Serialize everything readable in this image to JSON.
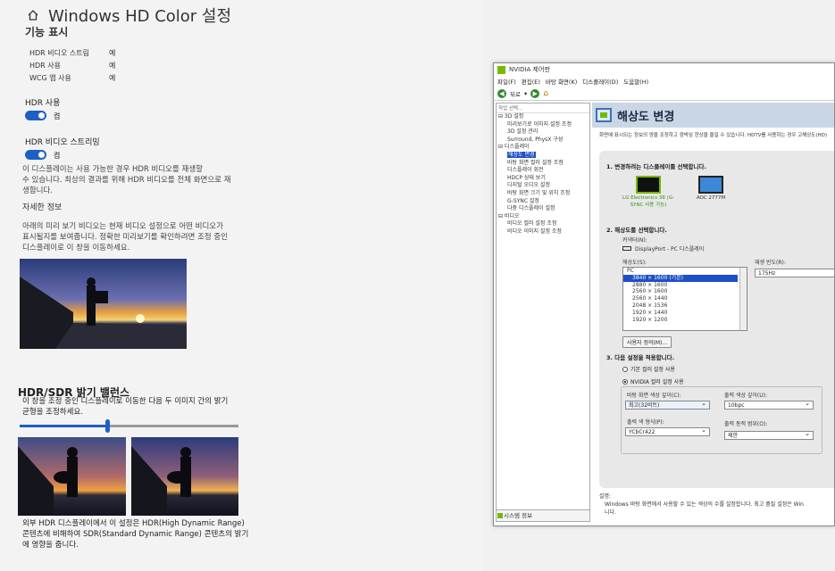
{
  "hdcolor": {
    "title": "Windows HD Color 설정",
    "section": "기능 표시",
    "features": [
      {
        "label": "HDR 비디오 스트림",
        "value": "예"
      },
      {
        "label": "HDR 사용",
        "value": "예"
      },
      {
        "label": "WCG 앱 사용",
        "value": "예"
      }
    ],
    "hdr_toggle": {
      "label": "HDR 사용",
      "state": "켬"
    },
    "stream_toggle": {
      "label": "HDR 비디오 스트리밍",
      "state": "켬"
    },
    "stream_desc": [
      "이 디스플레이는 사용 가능한 경우 HDR 비디오를 재생할",
      "수 있습니다. 최상의 결과를 위해 HDR 비디오를 전체 화면으로 재",
      "생합니다."
    ],
    "more_info": "자세한 정보",
    "preview_desc": [
      "아래의 미리 보기 비디오는 현재 비디오 설정으로 어떤 비디오가",
      "표시될지를 보여줍니다. 정확한 미리보기를 확인하려면 조정 중인",
      "디스플레이로 이 창을 이동하세요."
    ],
    "balance_title": "HDR/SDR 밝기 밸런스",
    "balance_desc": [
      "이 창을 조정 중인 디스플레이로 이동한 다음 두 이미지 간의 밝기",
      "균형을 조정하세요."
    ],
    "balance_value": 0.4,
    "footer_desc": [
      "외부 HDR 디스플레이에서 이 설정은 HDR(High Dynamic Range)",
      "콘텐츠에 비해하여 SDR(Standard Dynamic Range) 콘텐츠의 밝기",
      "에 영향을 줍니다."
    ]
  },
  "nvidia": {
    "title": "NVIDIA 제어판",
    "menu": [
      "파일(F)",
      "편집(E)",
      "바탕 화면(K)",
      "디스플레이(D)",
      "도움말(H)"
    ],
    "back_label": "뒤로",
    "nav_header": "작업 선택...",
    "nav": [
      {
        "text": "⊟ 3D 설정",
        "indent": 0,
        "selected": false
      },
      {
        "text": "미리보기로 이미지 설정 조정",
        "indent": 1,
        "selected": false
      },
      {
        "text": "3D 설정 관리",
        "indent": 1,
        "selected": false
      },
      {
        "text": "Surround, PhysX 구성",
        "indent": 1,
        "selected": false
      },
      {
        "text": "⊟ 디스플레이",
        "indent": 0,
        "selected": false
      },
      {
        "text": "해상도 변경",
        "indent": 1,
        "selected": true
      },
      {
        "text": "바탕 화면 컬러 설정 조정",
        "indent": 1,
        "selected": false
      },
      {
        "text": "디스플레이 회전",
        "indent": 1,
        "selected": false
      },
      {
        "text": "HDCP 상태 보기",
        "indent": 1,
        "selected": false
      },
      {
        "text": "디지털 오디오 설정",
        "indent": 1,
        "selected": false
      },
      {
        "text": "바탕 화면 크기 및 위치 조정",
        "indent": 1,
        "selected": false
      },
      {
        "text": "G-SYNC 설정",
        "indent": 1,
        "selected": false
      },
      {
        "text": "다중 디스플레이 설정",
        "indent": 1,
        "selected": false
      },
      {
        "text": "⊟ 비디오",
        "indent": 0,
        "selected": false
      },
      {
        "text": "비디오 컬러 설정 조정",
        "indent": 1,
        "selected": false
      },
      {
        "text": "비디오 이미지 설정 조정",
        "indent": 1,
        "selected": false
      }
    ],
    "system_info": "시스템 정보",
    "page_title": "해상도 변경",
    "page_desc": "화면에 표시되는 정보의 양을 조정하고 깜박임 현상을 줄일 수 있습니다. HDTV를 사용하는 경우 고해상도(HD)",
    "step1": "1. 변경하려는 디스플레이를 선택합니다.",
    "monitors": [
      {
        "caption": "LG Electronics 38 (G-SYNC 사용 가능)",
        "selected": true
      },
      {
        "caption": "AOC 2777M",
        "selected": false
      }
    ],
    "step2": "2. 해상도를 선택합니다.",
    "connector_label": "커넥터(N):",
    "connector_value": "DisplayPort - PC 디스플레이",
    "resolution_label": "해상도(S):",
    "refresh_label": "재생 빈도(R):",
    "refresh_value": "175Hz",
    "resolution_group": "PC",
    "resolutions": [
      "3840 × 1600 (기본)",
      "2880 × 1600",
      "2560 × 1600",
      "2560 × 1440",
      "2048 × 1536",
      "1920 × 1440",
      "1920 × 1200"
    ],
    "custom_button": "사용자 정의(M)...",
    "step3": "3. 다음 설정을 적용합니다.",
    "radio_default": "기본 컬러 설정 사용",
    "radio_nvidia": "NVIDIA 컬러 설정 사용",
    "depth_label": "바탕 화면 색상 깊이(C):",
    "depth_value": "최고(32비트)",
    "out_depth_label": "출력 색상 깊이(U):",
    "out_depth_value": "10bpc",
    "format_label": "출력 색 형식(P):",
    "format_value": "YCbCr422",
    "range_label": "출력 동적 범위(O):",
    "range_value": "제한",
    "desc_title": "설명:",
    "desc_text": "Windows 바탕 화면에서 사용할 수 있는 색상의 수를 설정합니다. 최고 품질 설정은 Win",
    "desc_text2": "니다."
  }
}
